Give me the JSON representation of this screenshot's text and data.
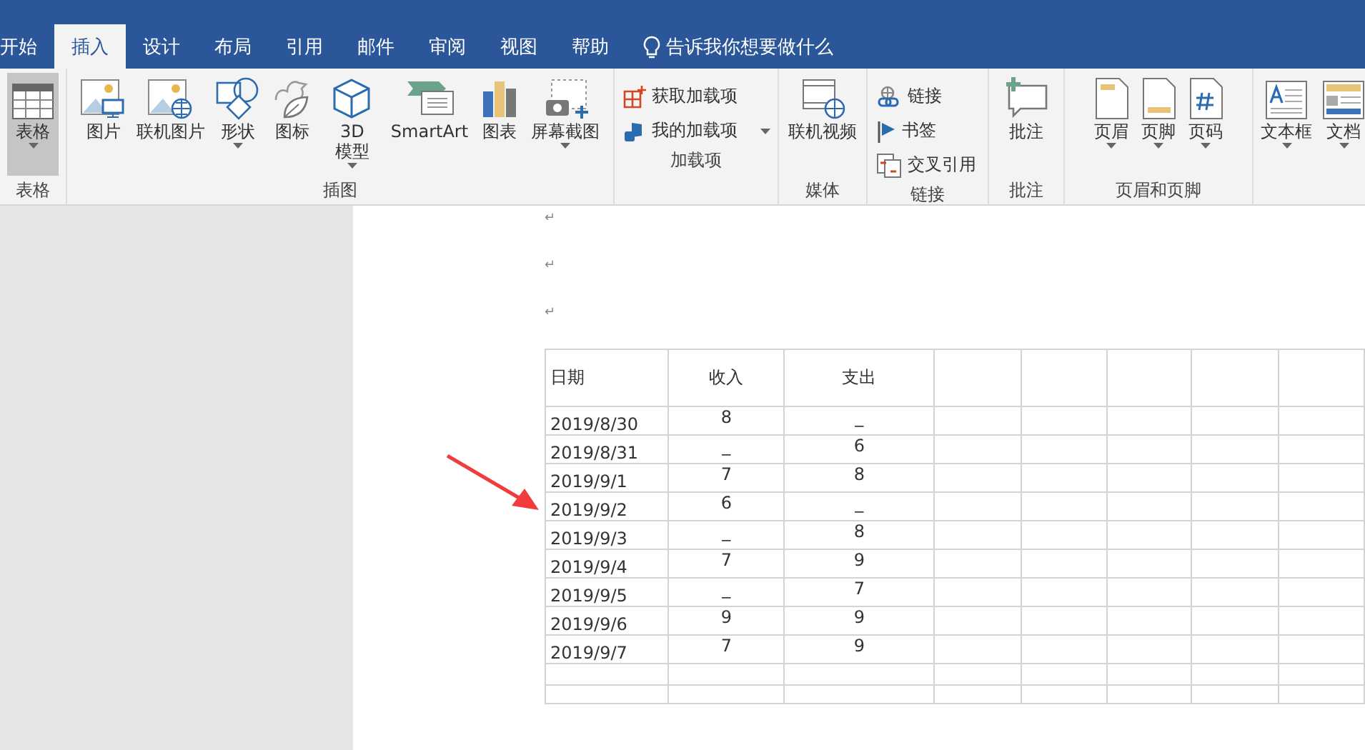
{
  "tabs": [
    {
      "label": "开始",
      "selected": false
    },
    {
      "label": "插入",
      "selected": true
    },
    {
      "label": "设计",
      "selected": false
    },
    {
      "label": "布局",
      "selected": false
    },
    {
      "label": "引用",
      "selected": false
    },
    {
      "label": "邮件",
      "selected": false
    },
    {
      "label": "审阅",
      "selected": false
    },
    {
      "label": "视图",
      "selected": false
    },
    {
      "label": "帮助",
      "selected": false
    }
  ],
  "tell_me": {
    "placeholder": "告诉我你想要做什么"
  },
  "ribbon": {
    "groups": [
      {
        "label": "表格",
        "items": [
          {
            "kind": "large",
            "label": "表格",
            "dropdown": true,
            "selected": true
          }
        ]
      },
      {
        "label": "插图",
        "items": [
          {
            "kind": "large",
            "label": "图片",
            "dropdown": false,
            "selected": false
          },
          {
            "kind": "large",
            "label": "联机图片",
            "dropdown": false,
            "selected": false
          },
          {
            "kind": "large",
            "label": "形状",
            "dropdown": true,
            "selected": false
          },
          {
            "kind": "large",
            "label": "图标",
            "dropdown": false,
            "selected": false
          },
          {
            "kind": "large",
            "label": "3D 模型",
            "dropdown": true,
            "selected": false
          },
          {
            "kind": "large",
            "label": "SmartArt",
            "dropdown": false,
            "selected": false
          },
          {
            "kind": "large",
            "label": "图表",
            "dropdown": false,
            "selected": false
          },
          {
            "kind": "large",
            "label": "屏幕截图",
            "dropdown": true,
            "selected": false
          }
        ]
      },
      {
        "label": "加载项",
        "items": [
          {
            "kind": "small",
            "label": "获取加载项",
            "dropdown": false,
            "selected": false
          },
          {
            "kind": "small",
            "label": "我的加载项",
            "dropdown": true,
            "selected": false
          }
        ]
      },
      {
        "label": "媒体",
        "items": [
          {
            "kind": "large",
            "label": "联机视频",
            "dropdown": false,
            "selected": false
          }
        ]
      },
      {
        "label": "链接",
        "items": [
          {
            "kind": "small",
            "label": "链接",
            "dropdown": false,
            "selected": false
          },
          {
            "kind": "small",
            "label": "书签",
            "dropdown": false,
            "selected": false
          },
          {
            "kind": "small",
            "label": "交叉引用",
            "dropdown": false,
            "selected": false
          }
        ]
      },
      {
        "label": "批注",
        "items": [
          {
            "kind": "large",
            "label": "批注",
            "dropdown": false,
            "selected": false
          }
        ]
      },
      {
        "label": "页眉和页脚",
        "items": [
          {
            "kind": "large",
            "label": "页眉",
            "dropdown": true,
            "selected": false
          },
          {
            "kind": "large",
            "label": "页脚",
            "dropdown": true,
            "selected": false
          },
          {
            "kind": "large",
            "label": "页码",
            "dropdown": true,
            "selected": false
          }
        ]
      },
      {
        "items": [
          {
            "kind": "large",
            "label": "文本框",
            "dropdown": true,
            "selected": false
          },
          {
            "kind": "large",
            "label": "文档",
            "dropdown": true,
            "selected": false
          }
        ]
      }
    ]
  },
  "document": {
    "paragraph_marks": [
      "↵",
      "↵",
      "↵"
    ],
    "table": {
      "columns": [
        "日期",
        "收入",
        "支出"
      ],
      "rows": [
        [
          "2019/8/30",
          "8",
          "_"
        ],
        [
          "2019/8/31",
          "_",
          "6"
        ],
        [
          "2019/9/1",
          "7",
          "8"
        ],
        [
          "2019/9/2",
          "6",
          "_"
        ],
        [
          "2019/9/3",
          "_",
          "8"
        ],
        [
          "2019/9/4",
          "7",
          "9"
        ],
        [
          "2019/9/5",
          "_",
          "7"
        ],
        [
          "2019/9/6",
          "9",
          "9"
        ],
        [
          "2019/9/7",
          "7",
          "9"
        ]
      ]
    }
  }
}
